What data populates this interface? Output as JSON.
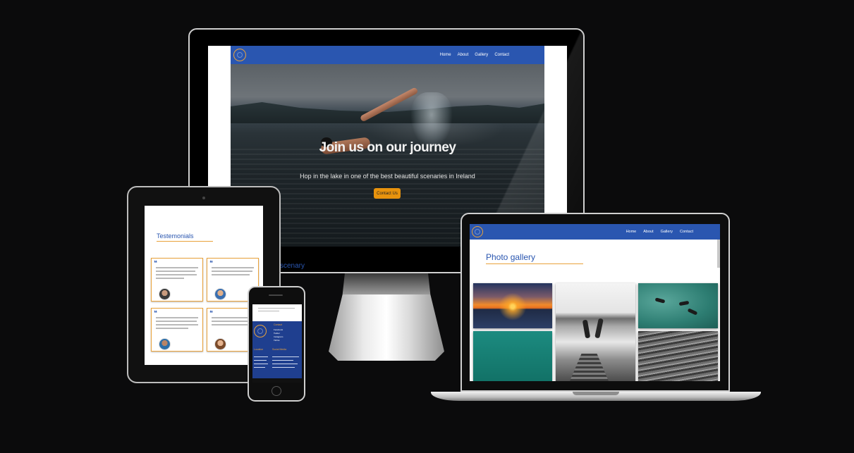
{
  "site": {
    "nav": [
      "Home",
      "About",
      "Gallery",
      "Contact"
    ]
  },
  "monitor": {
    "hero_title": "Join us on our journey",
    "hero_subtitle": "Hop in the lake in one of the best beautiful scenaries in Ireland",
    "hero_button": "Contact Us",
    "below_fold_text": "scenary"
  },
  "tablet": {
    "section_title": "Testemonials",
    "cards": [
      {
        "name": "",
        "quote_icon": "quote-icon"
      },
      {
        "name": "",
        "quote_icon": "quote-icon"
      },
      {
        "name": "",
        "quote_icon": "quote-icon"
      },
      {
        "name": "",
        "quote_icon": "quote-icon"
      }
    ]
  },
  "phone": {
    "footer_social_heading": "Contact",
    "social": [
      "Facebook",
      "Twitter",
      "Instagram",
      "TikTok"
    ],
    "col1_heading": "Location",
    "col2_heading": "Social Media"
  },
  "laptop": {
    "section_title": "Photo gallery"
  },
  "colors": {
    "nav_blue": "#2a56b0",
    "accent_orange": "#e9a23b",
    "button_orange": "#e8930d",
    "background": "#0b0b0c"
  }
}
